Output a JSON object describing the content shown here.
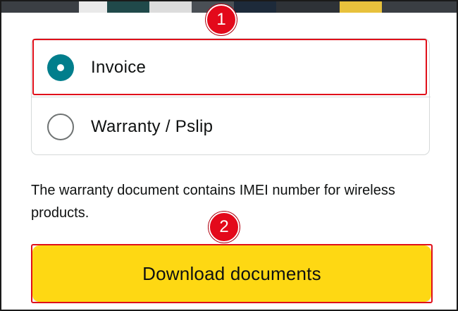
{
  "options": [
    {
      "label": "Invoice",
      "selected": true
    },
    {
      "label": "Warranty / Pslip",
      "selected": false
    }
  ],
  "note": "The warranty document contains IMEI number for wireless products.",
  "download_button": {
    "label": "Download documents"
  },
  "annotations": {
    "step1": "1",
    "step2": "2"
  },
  "colors": {
    "radio_selected": "#017e8c",
    "button_yellow": "#fed813",
    "annotation_red": "#e3091b"
  }
}
